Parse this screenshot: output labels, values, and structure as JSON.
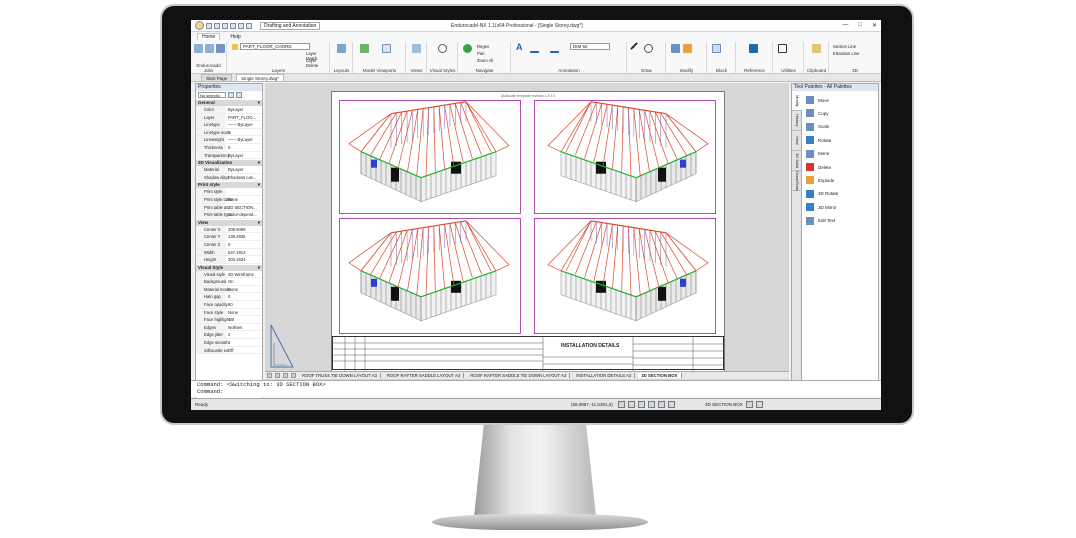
{
  "window": {
    "title": "Endurocadd-NX 1.1(x64 Professional - [Single Storey.dwg*]",
    "workspace": "Drafting and Annotation"
  },
  "menu": {
    "tabs": [
      "Home",
      "Help"
    ]
  },
  "ribbon": {
    "layer_value": "PART_FLOOR_CHORD",
    "layer_match": "Layer Match",
    "layer_delete": "Layer Delete",
    "dim_style": "DIM 50",
    "regen": "Regen",
    "pan": "Pan",
    "zoom_all": "Zoom All",
    "section_line": "Section Line",
    "elevation_line": "Elevation Line",
    "groups": [
      "Endurocadd Jobs",
      "Layers",
      "Layouts",
      "Model Viewports",
      "Views",
      "Visual Styles",
      "Navigate",
      "Annotation",
      "Draw",
      "Modify",
      "Block",
      "Reference",
      "Utilities",
      "Clipboard",
      "3D"
    ],
    "buttons": [
      "Load Job",
      "Update Job",
      "Explore Jobs",
      "New Layout",
      "Viewports",
      "Top",
      "2D Wireframe",
      "Orbit",
      "Text",
      "Dimension",
      "Dimension Section",
      "Leaders",
      "Line",
      "Move",
      "Insert Block",
      "Installation Details",
      "Group",
      "Paste"
    ]
  },
  "doc_tabs": [
    "Start Page",
    "Single Storey.dwg*"
  ],
  "properties": {
    "title": "Properties",
    "selection": "No selectio",
    "sections": [
      {
        "name": "General",
        "rows": [
          [
            "Color",
            "ByLayer"
          ],
          [
            "Layer",
            "PART_FLOO..."
          ],
          [
            "Linetype",
            "—— ByLayer"
          ],
          [
            "Linetype scale",
            "1"
          ],
          [
            "Lineweight",
            "—— ByLayer"
          ],
          [
            "Thickness",
            "0"
          ],
          [
            "Transparency",
            "ByLayer"
          ]
        ]
      },
      {
        "name": "3D Visualization",
        "rows": [
          [
            "Material",
            "ByLayer"
          ],
          [
            "Shadow displ",
            "Shadows cas..."
          ]
        ]
      },
      {
        "name": "Print style",
        "rows": [
          [
            "Print style",
            ""
          ],
          [
            "Print style table",
            "None"
          ],
          [
            "Print table att",
            "3D SECTION..."
          ],
          [
            "Print table type",
            "Color-depend..."
          ]
        ]
      },
      {
        "name": "View",
        "rows": [
          [
            "Center X",
            "209.5099"
          ],
          [
            "Center Y",
            "139.2935"
          ],
          [
            "Center Z",
            "0"
          ],
          [
            "Width",
            "547.1913"
          ],
          [
            "Height",
            "303.1634"
          ]
        ]
      },
      {
        "name": "Visual Style",
        "rows": [
          [
            "Visual style",
            "2D Wireframe"
          ],
          [
            "Background",
            "On"
          ],
          [
            "Material mode",
            "None"
          ],
          [
            "Halo gap",
            "0"
          ],
          [
            "Face opacity",
            "60"
          ],
          [
            "Face style",
            "None"
          ],
          [
            "Face highlight",
            "-30"
          ],
          [
            "Edges",
            "Isolines"
          ],
          [
            "Edge jitter",
            "2"
          ],
          [
            "Edge smooth",
            "1"
          ],
          [
            "Silhouette ed",
            "Off"
          ]
        ]
      }
    ]
  },
  "sheet": {
    "subtitle": "Quikscale template revision 1.8 1.0",
    "block_title": "INSTALLATION DETAILS"
  },
  "layout_tabs": [
    "ROOF TRUSS TIE DOWN LAYOUT A3",
    "ROOF RAFTER SADDLE LAYOUT A3",
    "ROOF RAFTER SADDLE TIE DOWN LAYOUT A3",
    "INSTALLATION DETAILS A3",
    "3D SECTION BOX"
  ],
  "active_layout": "3D SECTION BOX",
  "palette": {
    "title": "Tool Palettes - All Palettes",
    "side_tabs": [
      "Modify",
      "History",
      "View",
      "3D Solid",
      "Draw/Grids"
    ],
    "items": [
      "Move",
      "Copy",
      "Scale",
      "Rotate",
      "Mirror",
      "Delete",
      "Explode",
      "3D Rotate",
      "3D Mirror",
      "Edit Text"
    ]
  },
  "command": {
    "line1": "Command: <Switching to: 3D SECTION BOX>",
    "line2": "Command:"
  },
  "status": {
    "ready": "Ready",
    "coords": "(58.0887,-11.5361,0)",
    "mode": "3D SECTION BOX"
  },
  "colors": {
    "accent": "#1e66b4",
    "viewport_border": "#b04cb5",
    "truss": "#d94a2a",
    "frame": "#9c9c9c",
    "green": "#20b030",
    "blue": "#2a3fd6"
  }
}
